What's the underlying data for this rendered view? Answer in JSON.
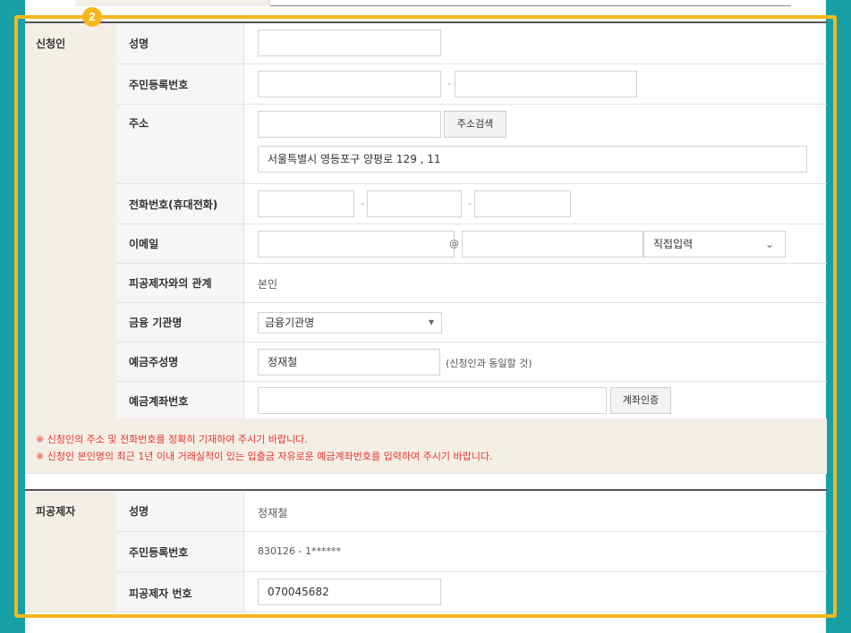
{
  "step_badge": "2",
  "applicant": {
    "section_label": "신청인",
    "name": {
      "label": "성명",
      "value": ""
    },
    "rrn": {
      "label": "주민등록번호",
      "front": "",
      "sep": "-",
      "back": ""
    },
    "address": {
      "label": "주소",
      "zipcode": "",
      "search_button": "주소검색",
      "detail": "서울특별시 영등포구 양평로 129 , 11"
    },
    "phone": {
      "label": "전화번호(휴대전화)",
      "p1": "",
      "sep1": "-",
      "p2": "",
      "sep2": "-",
      "p3": ""
    },
    "email": {
      "label": "이메일",
      "id": "",
      "at": "@",
      "domain": "",
      "domain_select": "직접입력"
    },
    "relation": {
      "label": "피공제자와의 관계",
      "value": "본인"
    },
    "bank": {
      "label": "금융 기관명",
      "select": "금융기관명"
    },
    "account_holder": {
      "label": "예금주성명",
      "value": "정재철",
      "note": "(신청인과 동일할 것)"
    },
    "account_number": {
      "label": "예금계좌번호",
      "value": "",
      "verify_button": "계좌인증"
    }
  },
  "notices": [
    "※ 신청인의 주소 및 전화번호를 정확히 기재하여 주시기 바랍니다.",
    "※ 신청인 본인명의 최근 1년 이내 거래실적이 있는 입출금 자유로운 예금계좌번호를 입력하여 주시기 바랍니다."
  ],
  "insured": {
    "section_label": "피공제자",
    "name": {
      "label": "성명",
      "value": "정재철"
    },
    "rrn": {
      "label": "주민등록번호",
      "value": "830126 - 1******"
    },
    "member_no": {
      "label": "피공제자 번호",
      "value": "070045682"
    }
  },
  "colors": {
    "frame": "#f5b71c",
    "background": "#16a0a6",
    "notice_text": "#e8352e",
    "section_bg": "#f4efe6"
  }
}
